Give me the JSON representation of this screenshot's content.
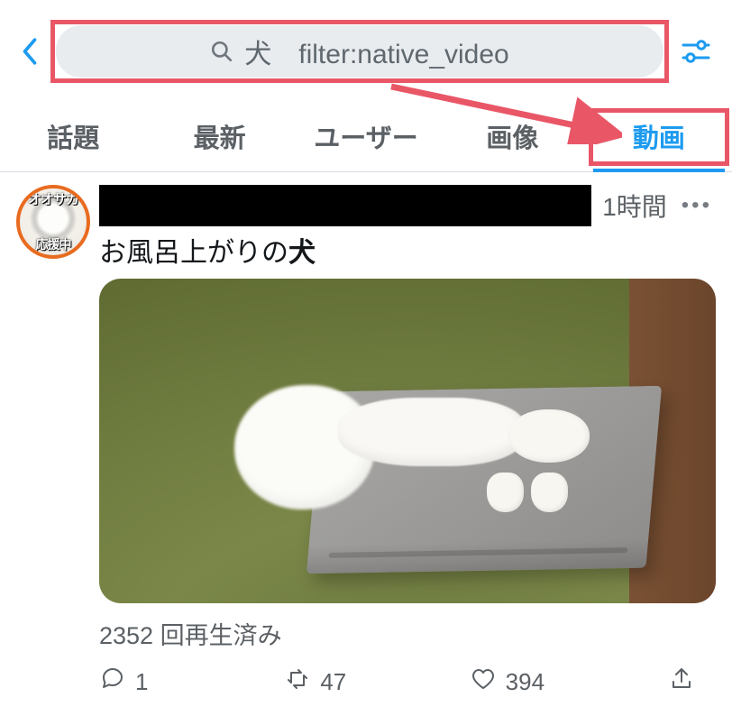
{
  "search": {
    "query": "犬　filter:native_video"
  },
  "tabs": [
    {
      "label": "話題"
    },
    {
      "label": "最新"
    },
    {
      "label": "ユーザー"
    },
    {
      "label": "画像"
    },
    {
      "label": "動画",
      "active": true
    }
  ],
  "tweet": {
    "avatar_top_text": "オオサカ",
    "avatar_bottom_text": "応援中",
    "timestamp": "1時間",
    "body_prefix": "お風呂上がりの",
    "body_keyword": "犬",
    "views_text": "2352 回再生済み",
    "reply_count": "1",
    "retweet_count": "47",
    "like_count": "394"
  }
}
